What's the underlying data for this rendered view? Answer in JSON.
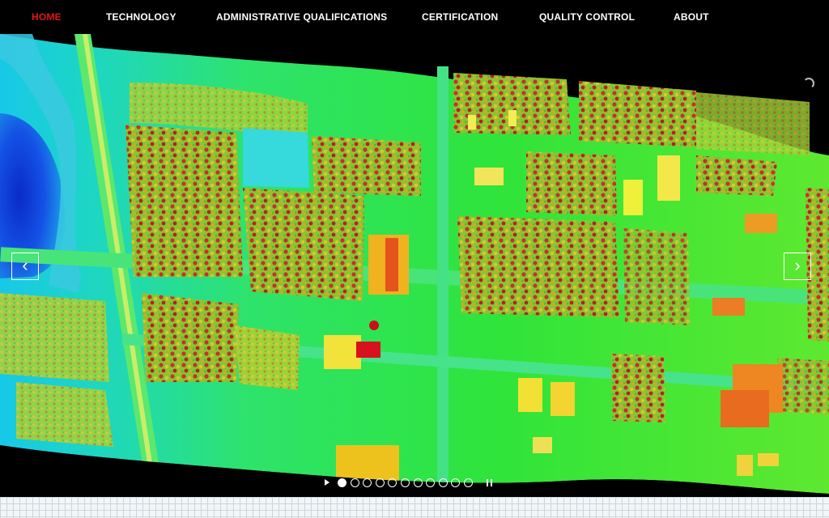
{
  "nav": {
    "items": [
      {
        "label": "HOME",
        "active": true
      },
      {
        "label": "TECHNOLOGY",
        "active": false
      },
      {
        "label": "ADMINISTRATIVE QUALIFICATIONS",
        "active": false
      },
      {
        "label": "CERTIFICATION",
        "active": false
      },
      {
        "label": "QUALITY CONTROL",
        "active": false
      },
      {
        "label": "ABOUT",
        "active": false
      }
    ]
  },
  "slider": {
    "prev_icon": "chevron-left-icon",
    "next_icon": "chevron-right-icon",
    "prev_glyph": "‹",
    "next_glyph": "›",
    "slide_count": 11,
    "active_slide": 1,
    "image": "lidar-elevation-map"
  },
  "colors": {
    "accent": "#e0141a",
    "nav_background": "#000000",
    "nav_text": "#ffffff",
    "lidar_low": "#0f3bd6",
    "lidar_mid": "#1be31b",
    "lidar_high": "#d8101c"
  }
}
